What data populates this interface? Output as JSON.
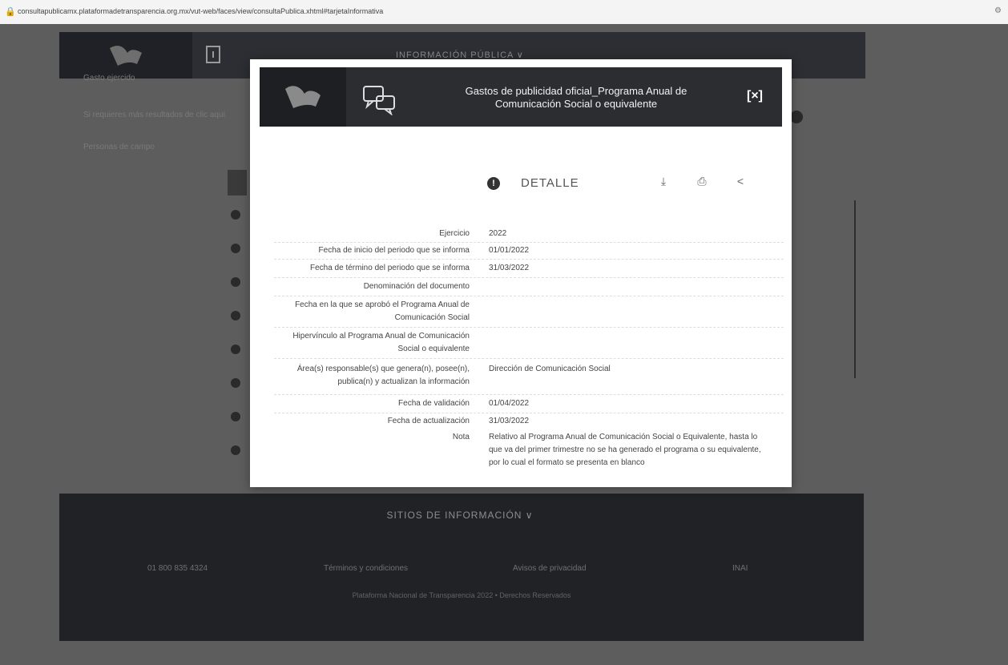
{
  "browser": {
    "url": "consultapublicamx.plataformadetransparencia.org.mx/vut-web/faces/view/consultaPublica.xhtml#tarjetaInformativa"
  },
  "page": {
    "nav_title": "INFORMACIÓN PÚBLICA ∨",
    "bg_texts": [
      "Gasto ejercido",
      "Si requieres más resultados de clic aquí",
      "Personas de campo"
    ]
  },
  "modal": {
    "title": "Gastos de publicidad oficial_Programa Anual de Comunicación Social o equivalente",
    "close_label": "[×]",
    "detail_label": "DETALLE",
    "fields": [
      {
        "label": "Ejercicio",
        "value": "2022"
      },
      {
        "label": "Fecha de inicio del periodo que se informa",
        "value": "01/01/2022"
      },
      {
        "label": "Fecha de término del periodo que se informa",
        "value": "31/03/2022"
      },
      {
        "label": "Denominación del documento",
        "value": ""
      },
      {
        "label": "Fecha en la que se aprobó el Programa Anual de Comunicación Social",
        "value": ""
      },
      {
        "label": "Hipervínculo al Programa Anual de Comunicación Social o equivalente",
        "value": ""
      },
      {
        "label": "Área(s) responsable(s) que genera(n), posee(n), publica(n) y actualizan la información",
        "value": "Dirección de Comunicación Social"
      },
      {
        "label": "Fecha de validación",
        "value": "01/04/2022"
      },
      {
        "label": "Fecha de actualización",
        "value": "31/03/2022"
      },
      {
        "label": "Nota",
        "value": "Relativo al Programa Anual de Comunicación Social o Equivalente, hasta lo que va del primer trimestre no se ha generado el programa o su equivalente, por lo cual el formato se presenta en blanco"
      }
    ]
  },
  "footer": {
    "sites_label": "SITIOS DE INFORMACIÓN ∨",
    "items": [
      "01 800 835 4324",
      "Términos y condiciones",
      "Avisos de privacidad",
      "INAI"
    ],
    "copyright": "Plataforma Nacional de Transparencia 2022 • Derechos Reservados"
  },
  "icons": {
    "logo": "eagle-logo-icon",
    "chat": "chat-bubbles-icon",
    "info": "info-icon",
    "download": "download-icon",
    "print": "print-icon",
    "share": "share-icon"
  }
}
